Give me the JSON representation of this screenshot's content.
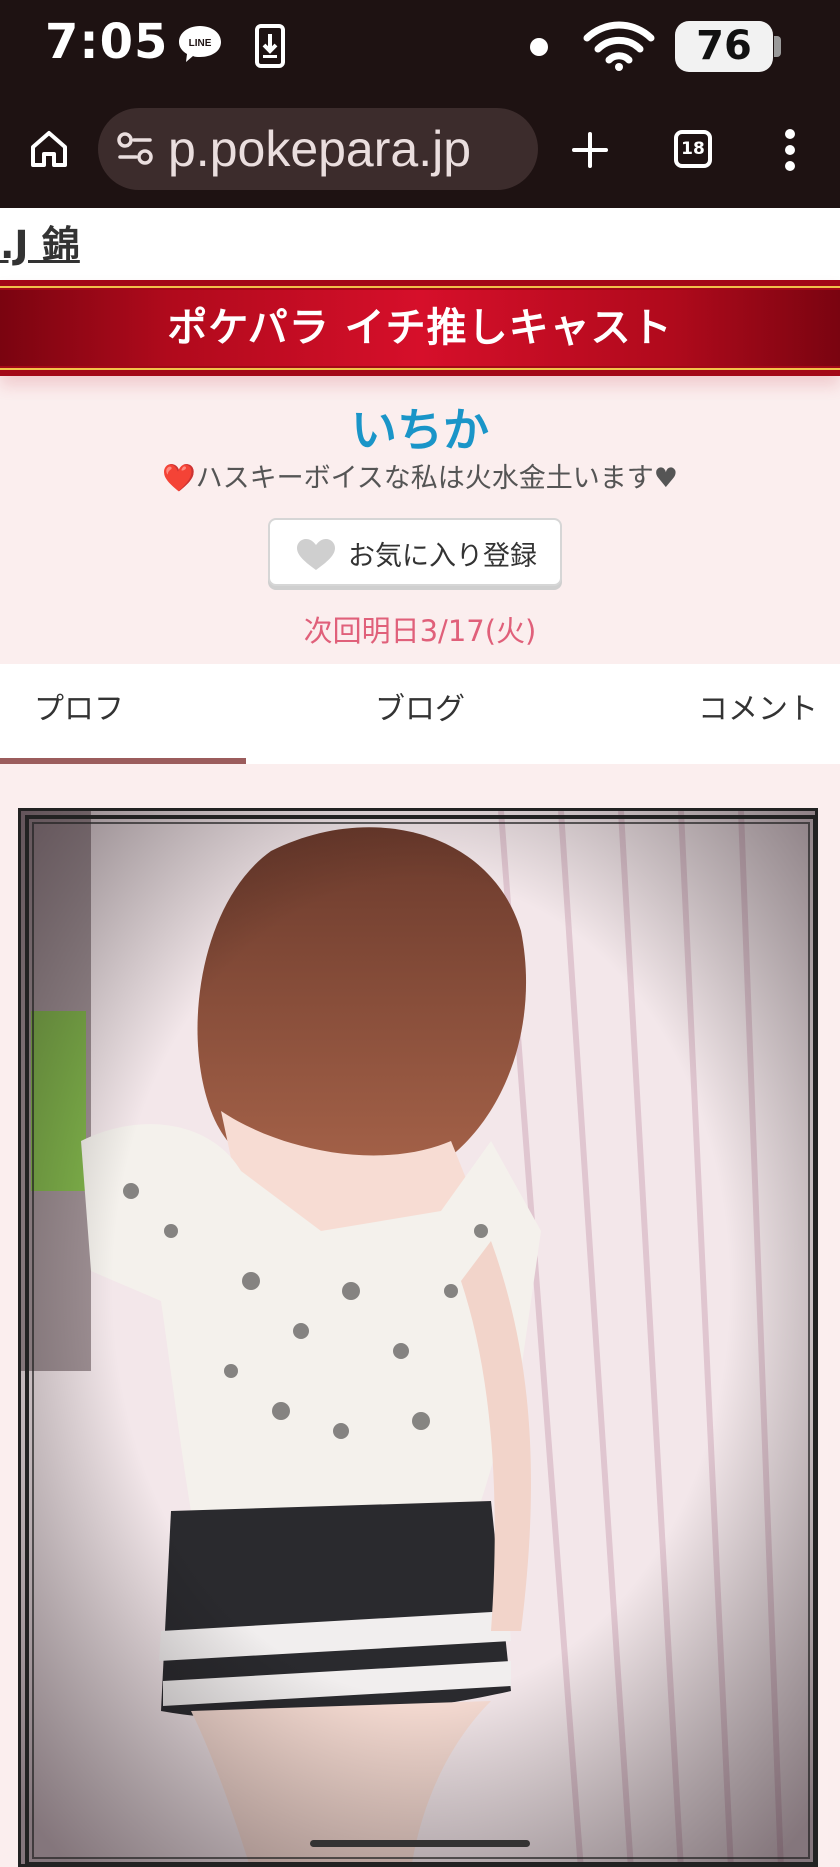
{
  "status_bar": {
    "time": "7:05",
    "notification_icons": [
      "line-icon",
      "download-icon",
      "dot-icon"
    ],
    "battery": "76"
  },
  "toolbar": {
    "url": "p.pokepara.jp",
    "tab_count": "18"
  },
  "page": {
    "shop_name": ".J 錦",
    "banner_title": "ポケパラ イチ推しキャスト",
    "cast_name": "いちか",
    "catch_copy": "❤️ハスキーボイスな私は火水金土います♥",
    "favorite_button": "お気に入り登録",
    "next_schedule": "次回明日3/17(火)",
    "tabs": [
      {
        "label": "プロフ",
        "active": true
      },
      {
        "label": "ブログ",
        "active": false
      },
      {
        "label": "コメント",
        "active": false
      }
    ]
  },
  "colors": {
    "banner_red": "#c40a20",
    "name_blue": "#1a95c8",
    "schedule_pink": "#e0607a",
    "page_bg": "#fbeeee"
  }
}
